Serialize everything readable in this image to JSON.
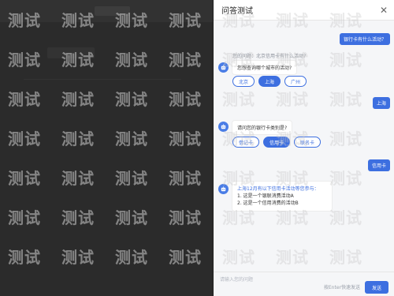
{
  "panel": {
    "title": "问答测试",
    "close_icon": "close-icon"
  },
  "chat": {
    "user_msg_1": "银行卡有什么活动？",
    "hint_1": "您的问题：北京信用卡有什么活动?",
    "bot_question_1": "您想查询哪个城市的活动?",
    "city_options": [
      "北京",
      "上海",
      "广州"
    ],
    "city_selected": "上海",
    "user_msg_2": "上海",
    "bot_question_2": "请问您的银行卡类别是?",
    "card_options": [
      "借记卡",
      "信用卡",
      "联名卡"
    ],
    "card_selected": "信用卡",
    "user_msg_3": "信用卡",
    "result_intro": "上海12月有以下信用卡活动等您参与：",
    "result_items": [
      "1. 这是一个银联消费活动A",
      "2. 这是一个信用消费的活动B"
    ]
  },
  "footer": {
    "input_placeholder": "请输入您的问题",
    "send_hint": "按Enter快速发送",
    "send_label": "发送"
  },
  "watermark": {
    "text": "测试"
  }
}
